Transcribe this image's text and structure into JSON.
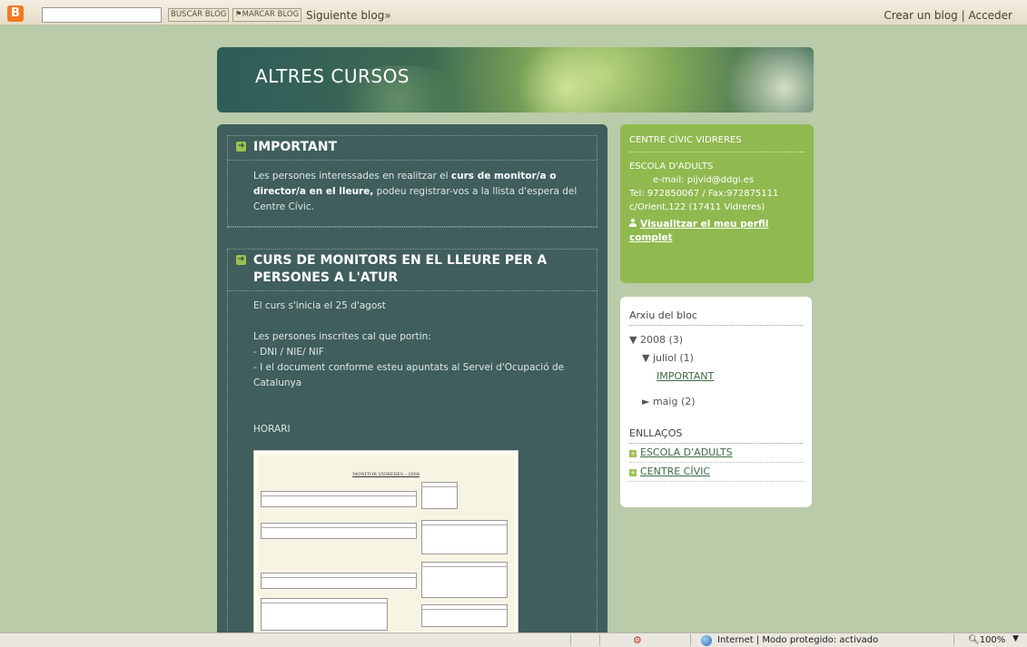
{
  "navbar": {
    "search_value": "",
    "search_button": "BUSCAR BLOG",
    "flag_button": "⚑MARCAR BLOG",
    "next_blog": "Siguiente blog»",
    "create_blog": "Crear un blog",
    "separator": "|",
    "login": "Acceder"
  },
  "header": {
    "title": "ALTRES CURSOS"
  },
  "posts": [
    {
      "title": "IMPORTANT",
      "body_1": "Les persones interessades en realitzar el ",
      "body_bold": "curs de monitor/a o director/a en el lleure,",
      "body_2": " podeu registrar-vos a la llista d'espera del Centre Cívic."
    },
    {
      "title": "CURS DE MONITORS EN EL LLEURE PER A PERSONES A L'ATUR",
      "lines": [
        "El curs s'inicia el 25 d'agost",
        "Les persones inscrites cal que portin:",
        "- DNI / NIE/ NIF",
        "- I el document conforme esteu apuntats al Servei d'Ocupació de Catalunya",
        "HORARI"
      ],
      "image_title": "MONITOR VIDRERES - 2008"
    }
  ],
  "profile": {
    "title": "CENTRE CÍVIC VIDRERES",
    "line1": "ESCOLA D'ADULTS",
    "email": "e-mail: pijvid@ddgi.es",
    "tel": "Tel: 972850067 / Fax:972875111",
    "address": "c/Orient,122 (17411 Vidreres)",
    "link": "Visualitzar el meu perfil complet"
  },
  "archive": {
    "title": "Arxiu del bloc",
    "year": "▼ 2008 (3)",
    "month_open": "▼ juliol (1)",
    "post_link": "IMPORTANT",
    "month_closed": "► maig (2)"
  },
  "links": {
    "title": "ENLLAÇOS",
    "items": [
      "ESCOLA D'ADULTS",
      "CENTRE CÍVIC"
    ]
  },
  "statusbar": {
    "zone": "Internet | Modo protegido: activado",
    "zoom": "100%"
  },
  "colors": {
    "background": "#b9cba8",
    "main_column": "#3f5e5c",
    "profile_box": "#90b94f",
    "bullet": "#9bc150"
  },
  "icons": [
    "blogger-logo-icon",
    "arrow-right-icon",
    "person-icon",
    "plus-bullet-icon",
    "globe-icon",
    "zoom-icon"
  ]
}
